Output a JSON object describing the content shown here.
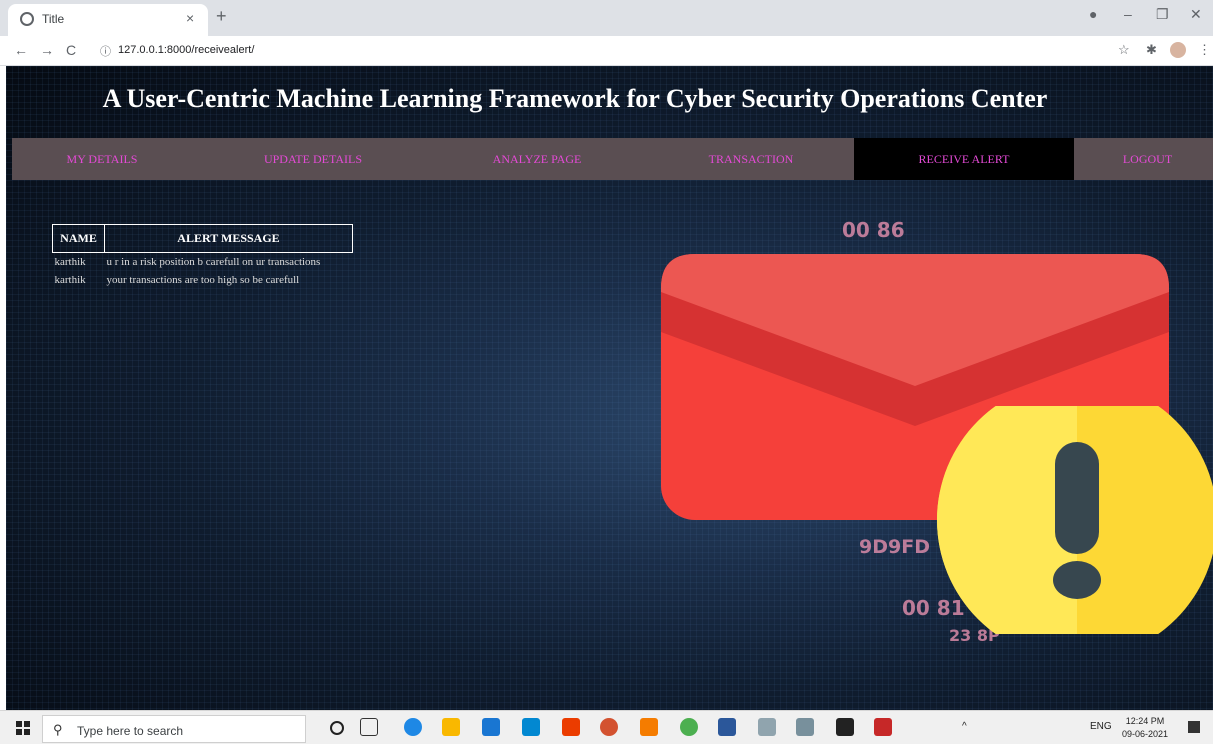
{
  "browser": {
    "tab_title": "Title",
    "url": "127.0.0.1:8000/receivealert/",
    "close_glyph": "×",
    "newtab_glyph": "+",
    "minimize_glyph": "–",
    "restore_glyph": "❐",
    "window_close_glyph": "✕",
    "back_glyph": "←",
    "forward_glyph": "→",
    "reload_glyph": "C",
    "info_glyph": "ⓘ",
    "star_glyph": "☆",
    "puzzle_glyph": "✱",
    "menu_glyph": "⋮"
  },
  "page": {
    "title": "A User-Centric Machine Learning Framework for Cyber Security Operations Center",
    "menu": [
      {
        "label": "MY DETAILS"
      },
      {
        "label": "UPDATE DETAILS"
      },
      {
        "label": "ANALYZE PAGE"
      },
      {
        "label": "TRANSACTION"
      },
      {
        "label": "RECEIVE ALERT",
        "active": true
      },
      {
        "label": "LOGOUT"
      }
    ],
    "table": {
      "headers": [
        "NAME",
        "ALERT MESSAGE"
      ],
      "rows": [
        [
          "karthik",
          "u r in a risk position b carefull on ur transactions"
        ],
        [
          "karthik",
          "your transactions are too high so be carefull"
        ]
      ]
    },
    "binary_text": [
      "00 86",
      "00 81",
      "9D9FD",
      "23 8P"
    ],
    "colors": {
      "menu_bg": "#5a4e52",
      "menu_text": "#e44ad6",
      "active_bg": "#000000",
      "envelope": "#f5403a",
      "warning": "#fdd835"
    }
  },
  "taskbar": {
    "search_placeholder": "Type here to search",
    "search_glyph": "⚲",
    "time": "12:24 PM",
    "date": "09-06-2021",
    "lang": "ENG"
  }
}
